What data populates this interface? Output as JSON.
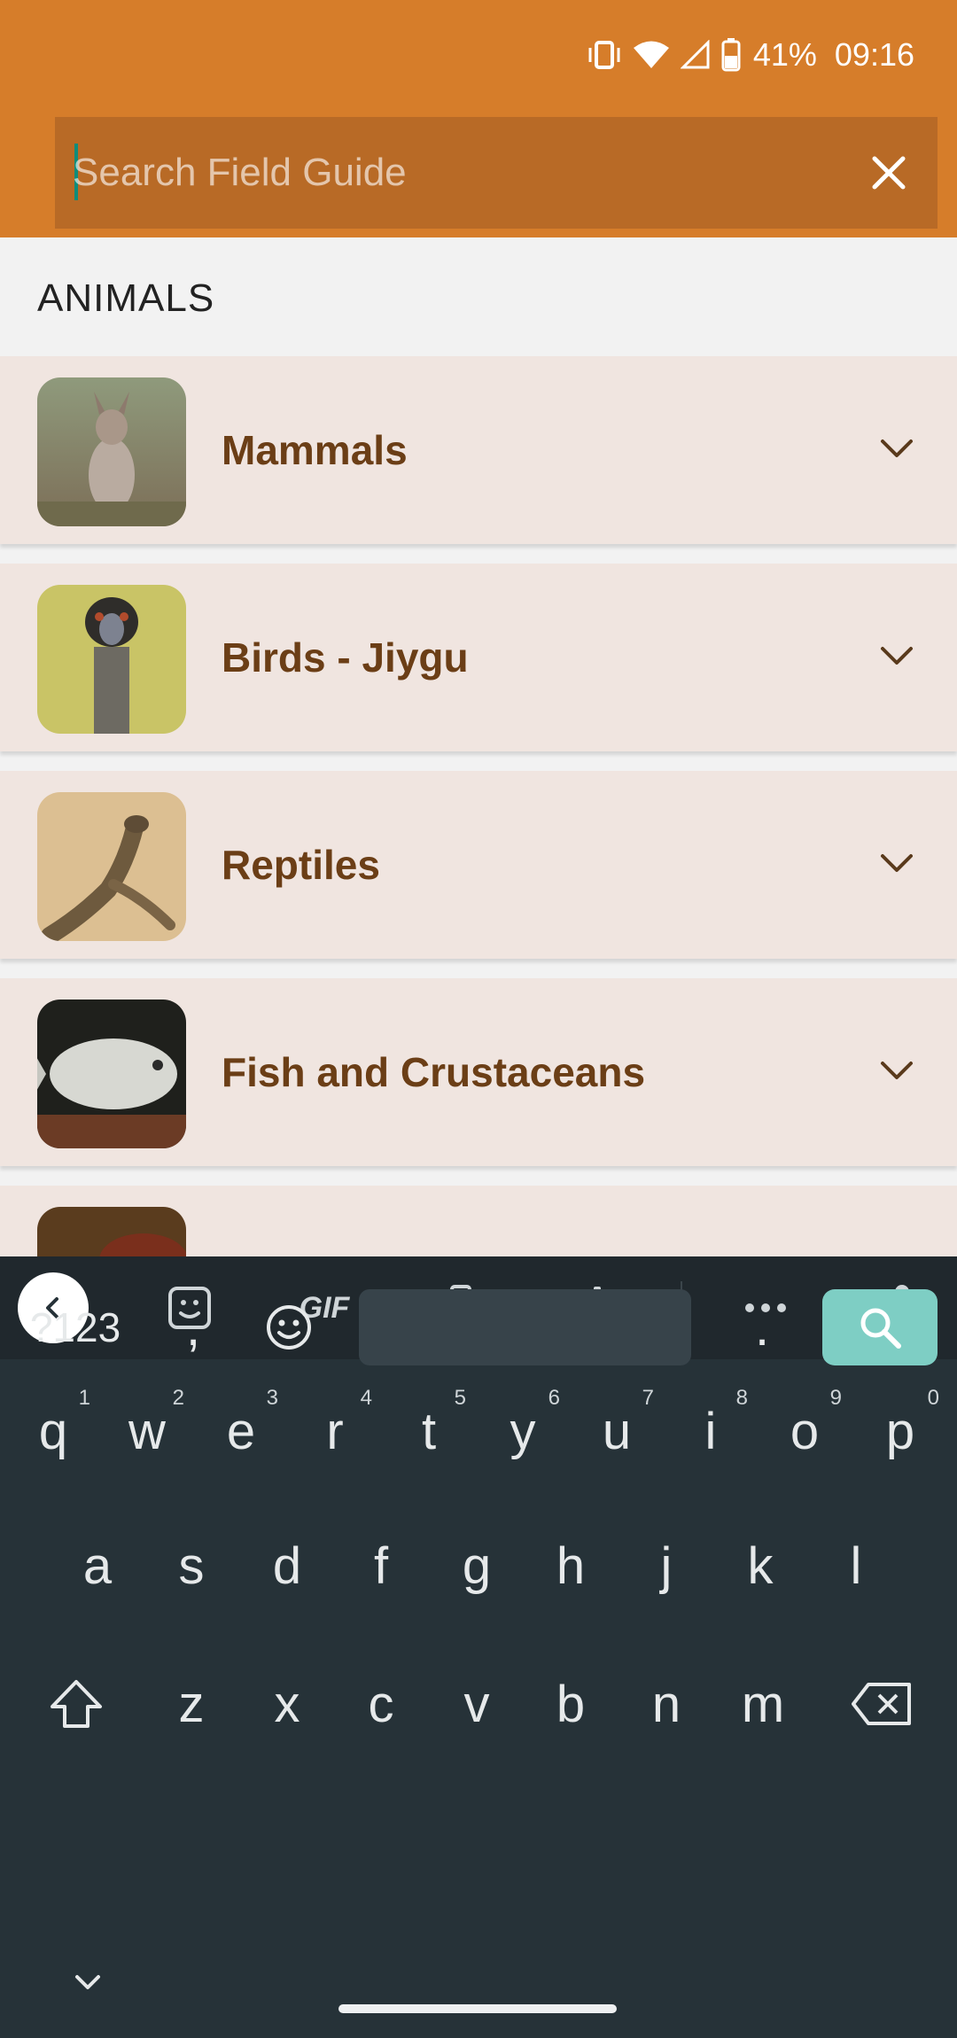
{
  "status_bar": {
    "battery_percent": "41%",
    "time": "09:16"
  },
  "search": {
    "placeholder": "Search Field Guide",
    "value": ""
  },
  "section_title": "ANIMALS",
  "categories": [
    {
      "label": "Mammals",
      "thumb": "kangaroo-photo"
    },
    {
      "label": "Birds - Jiygu",
      "thumb": "emu-photo"
    },
    {
      "label": "Reptiles",
      "thumb": "goanna-photo"
    },
    {
      "label": "Fish and Crustaceans",
      "thumb": "fish-photo"
    },
    {
      "label": "",
      "thumb": "partial-photo"
    }
  ],
  "keyboard": {
    "toolbar": [
      "back-icon",
      "sticker-icon",
      "gif-label",
      "clipboard-icon",
      "settings-icon",
      "more-icon",
      "mic-icon"
    ],
    "gif_label": "GIF",
    "row1": [
      "q",
      "w",
      "e",
      "r",
      "t",
      "y",
      "u",
      "i",
      "o",
      "p"
    ],
    "row1_hints": [
      "1",
      "2",
      "3",
      "4",
      "5",
      "6",
      "7",
      "8",
      "9",
      "0"
    ],
    "row2": [
      "a",
      "s",
      "d",
      "f",
      "g",
      "h",
      "j",
      "k",
      "l"
    ],
    "row3": [
      "z",
      "x",
      "c",
      "v",
      "b",
      "n",
      "m"
    ],
    "symbols_label": "?123",
    "comma": ",",
    "period": "."
  },
  "colors": {
    "header": "#d67d2a",
    "search_field": "#b86a26",
    "item_bg": "#f0e5e0",
    "item_text": "#6b3e16",
    "keyboard_bg": "#263238",
    "search_key": "#7ecec4"
  }
}
